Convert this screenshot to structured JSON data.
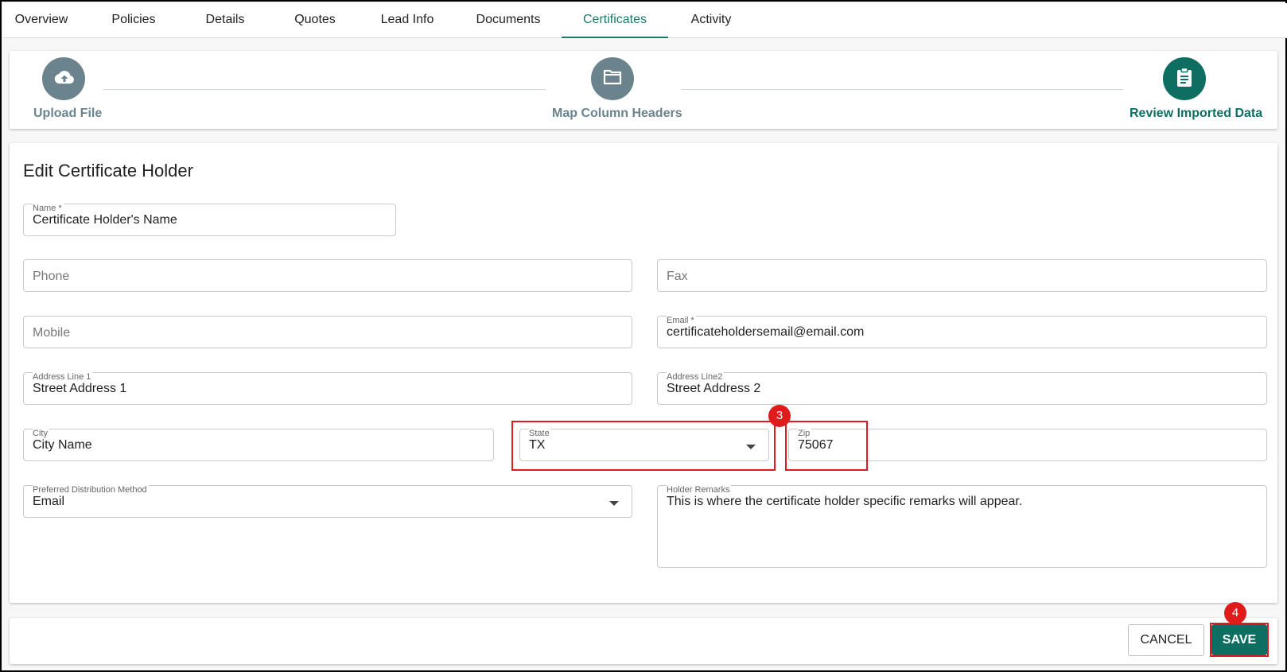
{
  "tabs": [
    {
      "label": "Overview"
    },
    {
      "label": "Policies"
    },
    {
      "label": "Details"
    },
    {
      "label": "Quotes"
    },
    {
      "label": "Lead Info"
    },
    {
      "label": "Documents"
    },
    {
      "label": "Certificates",
      "active": true
    },
    {
      "label": "Activity"
    }
  ],
  "stepper": {
    "steps": [
      {
        "label": "Upload File",
        "icon": "cloud-upload-icon"
      },
      {
        "label": "Map Column Headers",
        "icon": "folder-icon"
      },
      {
        "label": "Review Imported Data",
        "icon": "clipboard-icon",
        "active": true
      }
    ]
  },
  "form": {
    "title": "Edit Certificate Holder",
    "name": {
      "label": "Name *",
      "value": "Certificate Holder's Name"
    },
    "phone": {
      "placeholder": "Phone"
    },
    "fax": {
      "placeholder": "Fax"
    },
    "mobile": {
      "placeholder": "Mobile"
    },
    "email": {
      "label": "Email *",
      "value": "certificateholdersemail@email.com"
    },
    "address1": {
      "label": "Address Line 1",
      "value": "Street Address 1"
    },
    "address2": {
      "label": "Address Line2",
      "value": "Street Address 2"
    },
    "city": {
      "label": "City",
      "value": "City Name"
    },
    "state": {
      "label": "State",
      "value": "TX"
    },
    "zip": {
      "label": "Zip",
      "value": "75067"
    },
    "distribution": {
      "label": "Preferred Distribution Method",
      "value": "Email"
    },
    "remarks": {
      "label": "Holder Remarks",
      "value": "This is where the certificate holder specific remarks will appear."
    }
  },
  "annotations": {
    "badge3": "3",
    "badge4": "4"
  },
  "footer": {
    "cancel_label": "CANCEL",
    "save_label": "SAVE"
  },
  "colors": {
    "accent": "#0f6e62",
    "step_inactive": "#6b838c",
    "annotation": "#e01b1b"
  }
}
